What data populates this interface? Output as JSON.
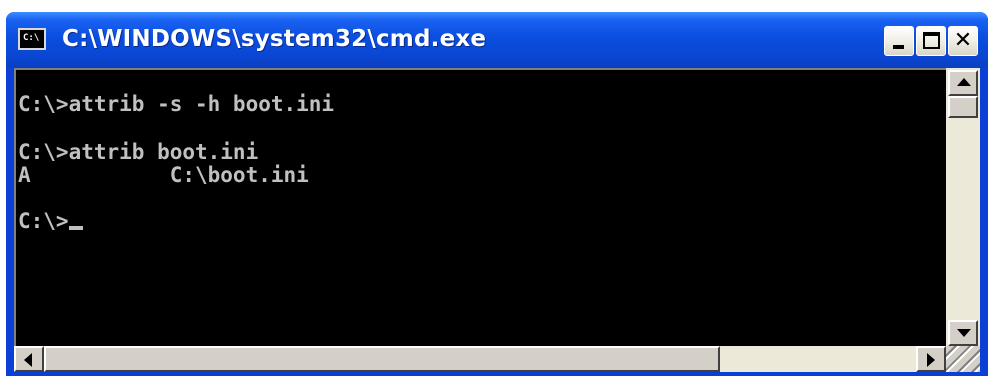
{
  "window": {
    "title": "C:\\WINDOWS\\system32\\cmd.exe",
    "icon_label": "C:\\",
    "icon": "cmd-icon",
    "buttons": {
      "minimize": "minimize-icon",
      "maximize": "maximize-icon",
      "close_glyph": "✕"
    }
  },
  "console": {
    "lines": [
      "C:\\>attrib -s -h boot.ini",
      "",
      "C:\\>attrib boot.ini",
      "A           C:\\boot.ini",
      "",
      "C:\\>"
    ],
    "text_color": "#c0c0c0",
    "background": "#000000"
  },
  "scrollbars": {
    "vertical": {
      "up": "scroll-up-arrow-icon",
      "down": "scroll-down-arrow-icon"
    },
    "horizontal": {
      "left": "scroll-left-arrow-icon",
      "right": "scroll-right-arrow-icon"
    }
  },
  "colors": {
    "titlebar": "#0a46d2",
    "frame": "#0b3fd6"
  }
}
